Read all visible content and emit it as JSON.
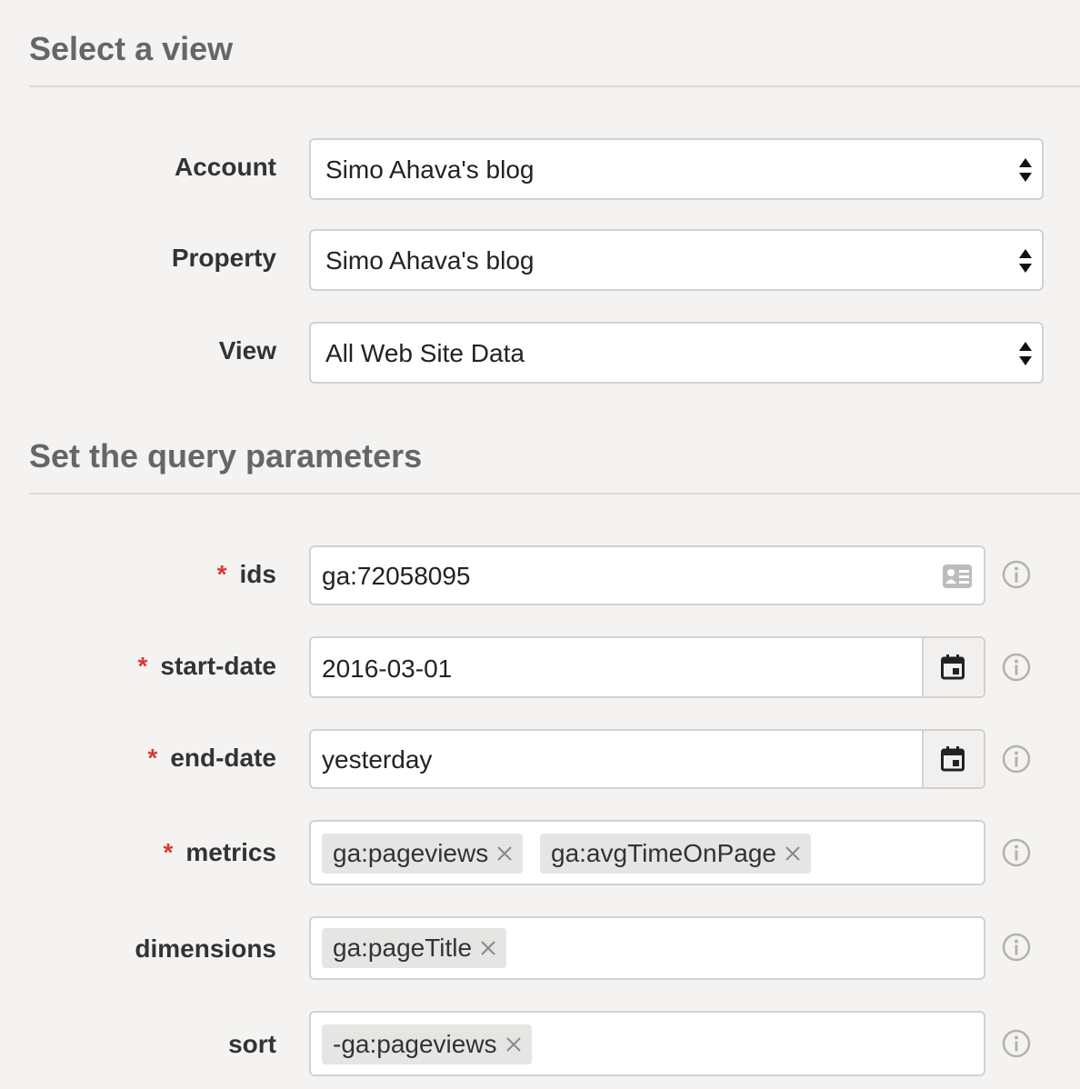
{
  "view_section": {
    "title": "Select a view",
    "account": {
      "label": "Account",
      "value": "Simo Ahava's blog"
    },
    "property": {
      "label": "Property",
      "value": "Simo Ahava's blog"
    },
    "view": {
      "label": "View",
      "value": "All Web Site Data"
    }
  },
  "query_section": {
    "title": "Set the query parameters",
    "required_marker": "*",
    "ids": {
      "label": "ids",
      "value": "ga:72058095"
    },
    "start_date": {
      "label": "start-date",
      "value": "2016-03-01"
    },
    "end_date": {
      "label": "end-date",
      "value": "yesterday"
    },
    "metrics": {
      "label": "metrics",
      "tags": [
        "ga:pageviews",
        "ga:avgTimeOnPage"
      ]
    },
    "dimensions": {
      "label": "dimensions",
      "tags": [
        "ga:pageTitle"
      ]
    },
    "sort": {
      "label": "sort",
      "tags": [
        "-ga:pageviews"
      ]
    }
  },
  "icons": {
    "select_arrows": "updown-arrows-icon",
    "ids_picker": "id-card-icon",
    "date_picker": "calendar-icon",
    "info": "info-icon",
    "tag_remove": "close-icon"
  },
  "colors": {
    "required": "#d63b32",
    "background": "#f4f3f1",
    "tag_background": "#e6e5e3"
  }
}
